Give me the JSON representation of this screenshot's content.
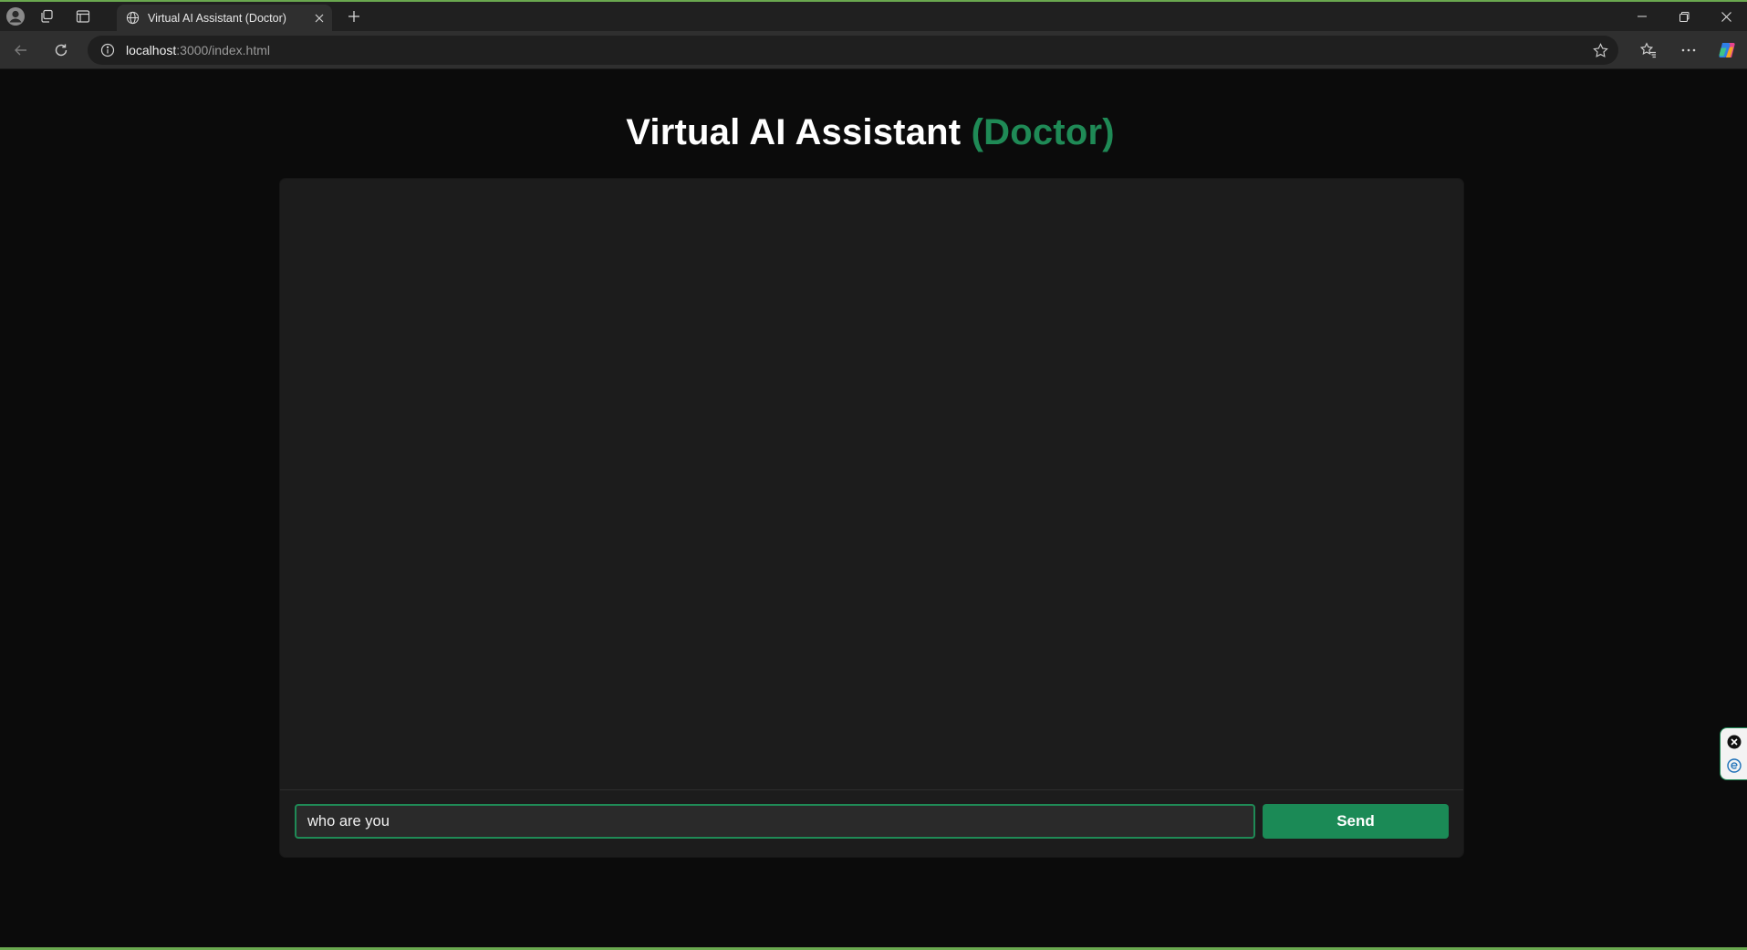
{
  "browser": {
    "tab": {
      "title": "Virtual AI Assistant (Doctor)"
    },
    "address": {
      "host": "localhost",
      "rest": ":3000/index.html"
    }
  },
  "page": {
    "title_main": "Virtual AI Assistant ",
    "title_accent": "(Doctor)",
    "accent_color": "#1f8a56"
  },
  "chat": {
    "input_value": "who are you",
    "send_label": "Send"
  },
  "icons": {
    "profile": "profile-icon",
    "workspaces": "workspaces-icon",
    "tab_actions": "tab-actions-icon",
    "globe": "globe-icon",
    "close": "close-icon",
    "new_tab": "plus-icon",
    "minimize": "minimize-icon",
    "restore": "restore-icon",
    "window_close": "window-close-icon",
    "back": "back-arrow-icon",
    "refresh": "refresh-icon",
    "info": "info-icon",
    "favorite": "star-icon",
    "favorites_bar": "favorites-icon",
    "more": "more-icon",
    "copilot": "copilot-icon"
  }
}
